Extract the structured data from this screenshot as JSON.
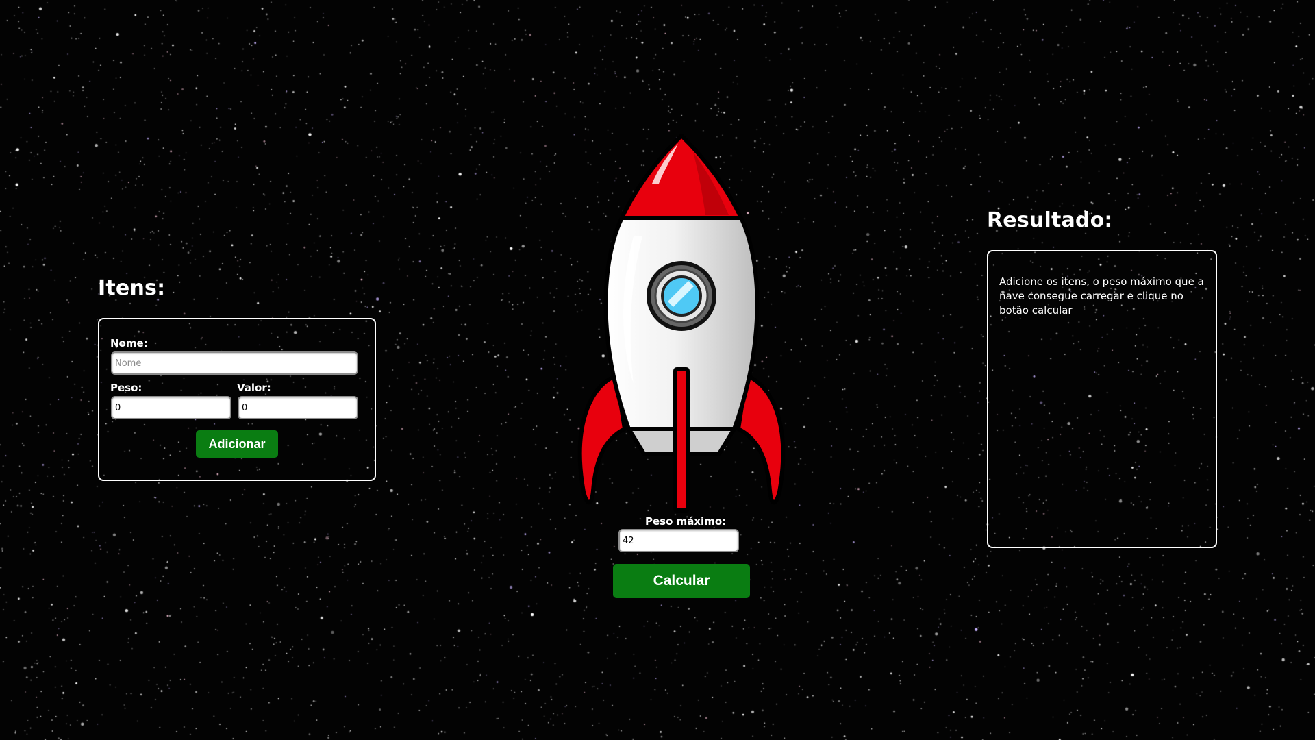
{
  "items_section": {
    "title": "Itens:",
    "name_label": "Nome:",
    "name_placeholder": "Nome",
    "name_value": "",
    "weight_label": "Peso:",
    "weight_value": "0",
    "value_label": "Valor:",
    "value_value": "0",
    "add_button": "Adicionar"
  },
  "center": {
    "rocket_icon": "rocket-illustration",
    "max_weight_label": "Peso máximo:",
    "max_weight_value": "42",
    "calculate_button": "Calcular"
  },
  "result_section": {
    "title": "Resultado:",
    "message": "Adicione os itens, o peso máximo que a nave consegue carregar e clique no botão calcular"
  },
  "colors": {
    "background": "#000000",
    "button_green": "#0a7d12",
    "rocket_red": "#e8000d",
    "panel_border": "#ffffff"
  }
}
